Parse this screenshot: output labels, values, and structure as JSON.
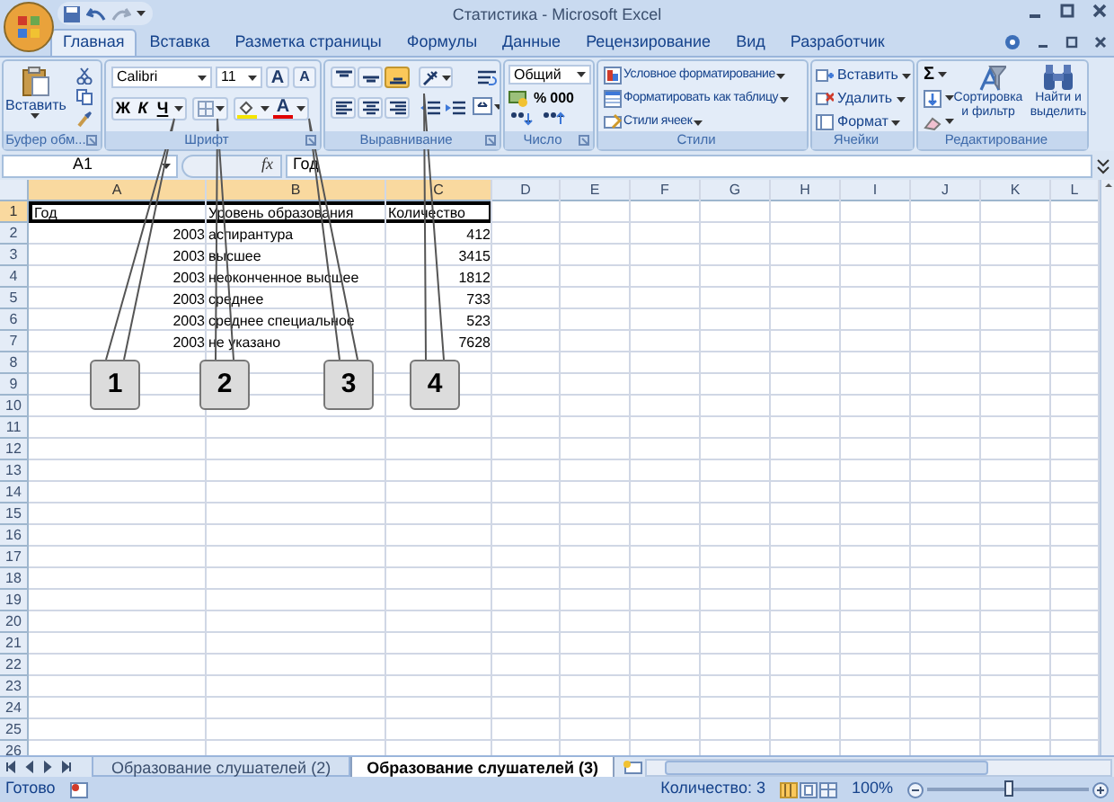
{
  "window": {
    "title": "Статистика - Microsoft Excel"
  },
  "tabs": [
    {
      "label": "Главная",
      "selected": true
    },
    {
      "label": "Вставка",
      "selected": false
    },
    {
      "label": "Разметка страницы",
      "selected": false
    },
    {
      "label": "Формулы",
      "selected": false
    },
    {
      "label": "Данные",
      "selected": false
    },
    {
      "label": "Рецензирование",
      "selected": false
    },
    {
      "label": "Вид",
      "selected": false
    },
    {
      "label": "Разработчик",
      "selected": false
    }
  ],
  "ribbon": {
    "clipboard": {
      "label": "Буфер обм...",
      "paste": "Вставить"
    },
    "font": {
      "label": "Шрифт",
      "font_name": "Calibri",
      "font_size": "11",
      "grow_font": "A",
      "shrink_font": "A",
      "bold": "Ж",
      "italic": "К",
      "underline": "Ч",
      "font_color": "A"
    },
    "alignment": {
      "label": "Выравнивание"
    },
    "number": {
      "label": "Число",
      "format": "Общий",
      "percent": "%",
      "thousands": "000"
    },
    "styles": {
      "label": "Стили",
      "items": [
        "Условное форматирование",
        "Форматировать как таблицу",
        "Стили ячеек"
      ]
    },
    "cells": {
      "label": "Ячейки",
      "items": [
        "Вставить",
        "Удалить",
        "Формат"
      ]
    },
    "editing": {
      "label": "Редактирование",
      "sum": "Σ",
      "sort": "Сортировка и фильтр",
      "find": "Найти и выделить"
    }
  },
  "formula_bar": {
    "name_box": "A1",
    "function_label": "fx",
    "value": "Год"
  },
  "columns": [
    {
      "label": "A",
      "selected": true
    },
    {
      "label": "B",
      "selected": true
    },
    {
      "label": "C",
      "selected": true
    },
    {
      "label": "D",
      "selected": false
    },
    {
      "label": "E",
      "selected": false
    },
    {
      "label": "F",
      "selected": false
    },
    {
      "label": "G",
      "selected": false
    },
    {
      "label": "H",
      "selected": false
    },
    {
      "label": "I",
      "selected": false
    },
    {
      "label": "J",
      "selected": false
    },
    {
      "label": "K",
      "selected": false
    },
    {
      "label": "L",
      "selected": false
    }
  ],
  "rows": [
    {
      "number": "1",
      "selected": true,
      "cells": [
        "Год",
        "Уровень образования",
        "Количество"
      ]
    },
    {
      "number": "2",
      "selected": false,
      "cells": [
        "2003",
        "аспирантура",
        "412"
      ]
    },
    {
      "number": "3",
      "selected": false,
      "cells": [
        "2003",
        "высшее",
        "3415"
      ]
    },
    {
      "number": "4",
      "selected": false,
      "cells": [
        "2003",
        "неоконченное высшее",
        "1812"
      ]
    },
    {
      "number": "5",
      "selected": false,
      "cells": [
        "2003",
        "среднее",
        "733"
      ]
    },
    {
      "number": "6",
      "selected": false,
      "cells": [
        "2003",
        "среднее специальное",
        "523"
      ]
    },
    {
      "number": "7",
      "selected": false,
      "cells": [
        "2003",
        "не указано",
        "7628"
      ]
    },
    {
      "number": "8",
      "selected": false
    },
    {
      "number": "9",
      "selected": false
    },
    {
      "number": "10",
      "selected": false
    },
    {
      "number": "11",
      "selected": false
    },
    {
      "number": "12",
      "selected": false
    },
    {
      "number": "13",
      "selected": false
    },
    {
      "number": "14",
      "selected": false
    },
    {
      "number": "15",
      "selected": false
    },
    {
      "number": "16",
      "selected": false
    },
    {
      "number": "17",
      "selected": false
    },
    {
      "number": "18",
      "selected": false
    },
    {
      "number": "19",
      "selected": false
    },
    {
      "number": "20",
      "selected": false
    },
    {
      "number": "21",
      "selected": false
    },
    {
      "number": "22",
      "selected": false
    },
    {
      "number": "23",
      "selected": false
    },
    {
      "number": "24",
      "selected": false
    },
    {
      "number": "25",
      "selected": false
    },
    {
      "number": "26",
      "selected": false
    }
  ],
  "callouts": [
    "1",
    "2",
    "3",
    "4"
  ],
  "sheet_tabs": [
    {
      "label": "Образование слушателей (2)",
      "selected": false
    },
    {
      "label": "Образование слушателей (3)",
      "selected": true
    }
  ],
  "status_bar": {
    "status": "Готово",
    "count": "Количество: 3",
    "zoom": "100%",
    "zoom_slider": {
      "level": 0.5
    }
  }
}
